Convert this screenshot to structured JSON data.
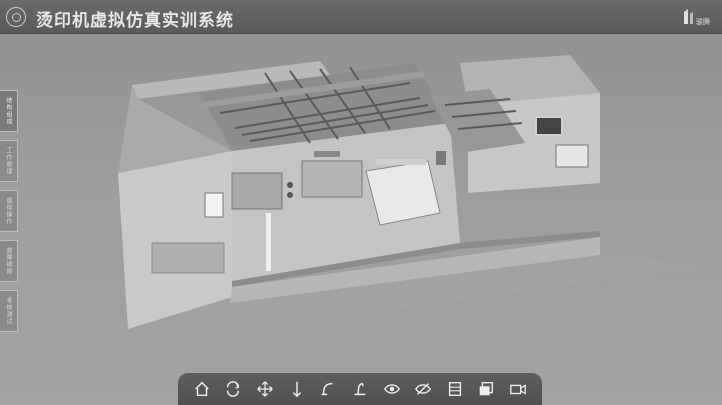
{
  "app": {
    "title": "烫印机虚拟仿真实训系统",
    "brand": "骏腾"
  },
  "sidebar": {
    "items": [
      {
        "label": "结构组成",
        "active": true
      },
      {
        "label": "工作原理",
        "active": false
      },
      {
        "label": "虚拟操作",
        "active": false
      },
      {
        "label": "故障排除",
        "active": false
      },
      {
        "label": "考核测试",
        "active": false
      }
    ]
  },
  "toolbar": {
    "tools": [
      {
        "name": "home-icon"
      },
      {
        "name": "rotate-icon"
      },
      {
        "name": "pan-icon"
      },
      {
        "name": "zoom-icon"
      },
      {
        "name": "disassemble-icon"
      },
      {
        "name": "assemble-icon"
      },
      {
        "name": "show-icon"
      },
      {
        "name": "hide-icon"
      },
      {
        "name": "transparent-icon"
      },
      {
        "name": "solid-icon"
      },
      {
        "name": "camera-icon"
      }
    ]
  },
  "colors": {
    "titlebar": "#5d5d5d",
    "background": "#9a9a9a",
    "toolbar": "#565656"
  }
}
